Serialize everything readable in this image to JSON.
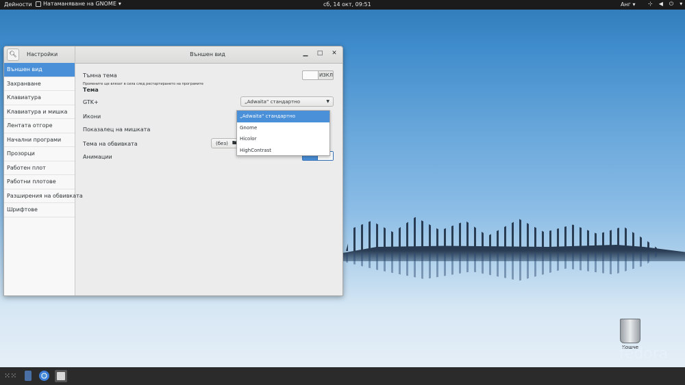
{
  "top_bar": {
    "activities": "Дейности",
    "app_menu": "Натаманяване на GNOME",
    "clock": "сб, 14 окт, 09:51",
    "language": "Анг"
  },
  "window": {
    "sidebar_title": "Настройки",
    "main_title": "Външен вид"
  },
  "sidebar": {
    "items": [
      {
        "label": "Външен вид",
        "selected": true
      },
      {
        "label": "Захранване"
      },
      {
        "label": "Клавиатура"
      },
      {
        "label": "Клавиатура и мишка"
      },
      {
        "label": "Лентата отгоре"
      },
      {
        "label": "Начални програми"
      },
      {
        "label": "Прозорци"
      },
      {
        "label": "Работен плот"
      },
      {
        "label": "Работни плотове"
      },
      {
        "label": "Разширения на обвивката"
      },
      {
        "label": "Шрифтове"
      }
    ]
  },
  "content": {
    "dark_theme_label": "Тъмна тема",
    "dark_theme_note": "Промените ще влязат в сила след рестартирането на програмите",
    "dark_theme_switch": "ИЗКЛ",
    "theme_header": "Тема",
    "gtk_label": "GTK+",
    "gtk_value": "„Adwaita“ стандартно",
    "icons_label": "Икони",
    "cursor_label": "Показалец на мишката",
    "shell_theme_label": "Тема на обвивката",
    "shell_theme_value": "(без)",
    "animations_label": "Анимации"
  },
  "gtk_menu": {
    "options": [
      "„Adwaita“ стандартно",
      "Gnome",
      "Hicolor",
      "HighContrast"
    ],
    "selected_index": 0
  },
  "desktop": {
    "trash_label": "Кошче",
    "brand": "fedora"
  },
  "colors": {
    "accent": "#4a90d9",
    "top_bar": "#1b1b1b",
    "dash": "#2b2b2b"
  }
}
